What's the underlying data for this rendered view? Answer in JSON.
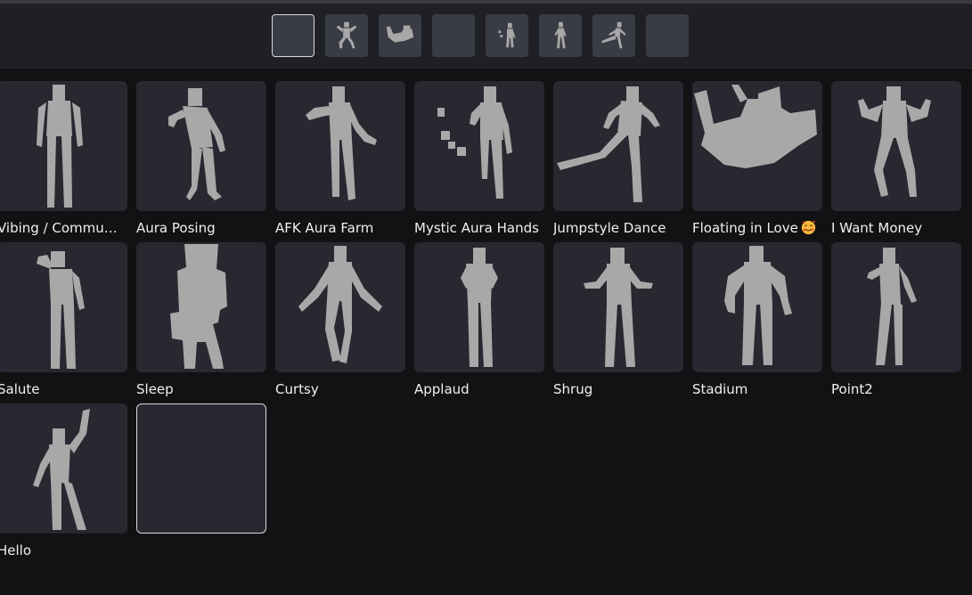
{
  "toolbar": {
    "slots": [
      {
        "icon": "empty-slot",
        "selected": true
      },
      {
        "icon": "figure-jumping-icon"
      },
      {
        "icon": "figure-floating-icon"
      },
      {
        "icon": "empty-slot"
      },
      {
        "icon": "figure-aura-hands-icon"
      },
      {
        "icon": "figure-standing-icon"
      },
      {
        "icon": "figure-kick-icon"
      },
      {
        "icon": "empty-slot"
      }
    ]
  },
  "emotes": [
    {
      "label": "Vibing / Commu…",
      "icon": "figure-vibing-icon"
    },
    {
      "label": "Aura Posing",
      "icon": "figure-aura-posing-icon"
    },
    {
      "label": "AFK Aura Farm",
      "icon": "figure-afk-aura-farm-icon"
    },
    {
      "label": "Mystic Aura Hands",
      "icon": "figure-mystic-aura-hands-icon"
    },
    {
      "label": "Jumpstyle Dance",
      "icon": "figure-jumpstyle-icon"
    },
    {
      "label": "Floating in Love",
      "icon": "figure-floating-icon",
      "emoji": "smiling-face-with-hearts-emoji"
    },
    {
      "label": "I Want Money",
      "icon": "figure-i-want-money-icon"
    },
    {
      "label": "Salute",
      "icon": "figure-salute-icon"
    },
    {
      "label": "Sleep",
      "icon": "figure-sleep-icon"
    },
    {
      "label": "Curtsy",
      "icon": "figure-curtsy-icon"
    },
    {
      "label": "Applaud",
      "icon": "figure-applaud-icon"
    },
    {
      "label": "Shrug",
      "icon": "figure-shrug-icon"
    },
    {
      "label": "Stadium",
      "icon": "figure-stadium-icon"
    },
    {
      "label": "Point2",
      "icon": "figure-point-icon"
    },
    {
      "label": "Hello",
      "icon": "figure-hello-icon"
    },
    {
      "label": "",
      "icon": "empty-slot",
      "selected": true
    }
  ],
  "colors": {
    "background": "#121214",
    "toolbar": "#1f2026",
    "card": "#272830",
    "slot": "#3a3c45",
    "figure": "#a8a8a8",
    "selected_border": "#d9d9de"
  }
}
